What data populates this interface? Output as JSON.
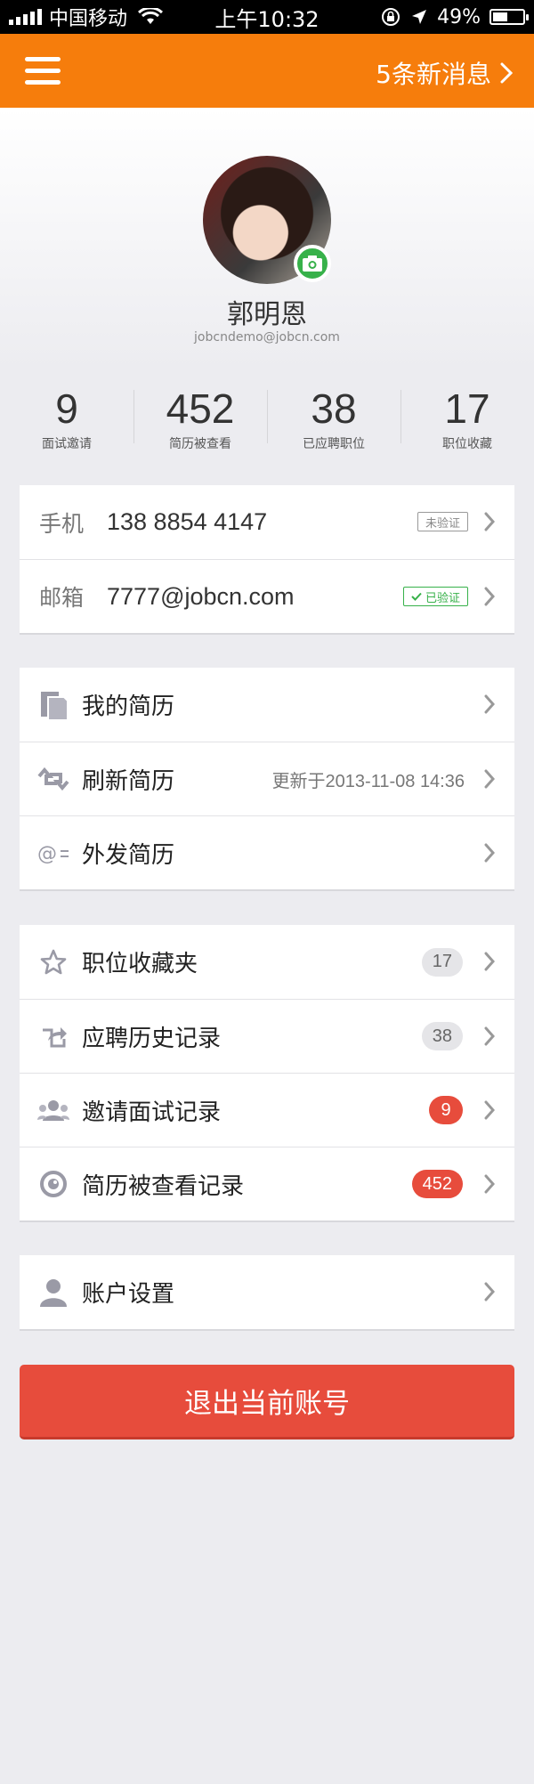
{
  "status_bar": {
    "carrier": "中国移动",
    "time": "上午10:32",
    "battery": "49%",
    "battery_level": 0.49
  },
  "header": {
    "menu_icon": "hamburger-menu-icon",
    "messages_label": "5条新消息"
  },
  "profile": {
    "name": "郭明恩",
    "email": "jobcndemo@jobcn.com"
  },
  "stats": [
    {
      "value": "9",
      "label": "面试邀请"
    },
    {
      "value": "452",
      "label": "简历被查看"
    },
    {
      "value": "38",
      "label": "已应聘职位"
    },
    {
      "value": "17",
      "label": "职位收藏"
    }
  ],
  "contact": {
    "phone": {
      "label": "手机",
      "value": "138 8854 4147",
      "status": "未验证"
    },
    "email": {
      "label": "邮箱",
      "value": "7777@jobcn.com",
      "status": "已验证"
    }
  },
  "resume": {
    "my_resume": "我的简历",
    "refresh": "刷新简历",
    "refresh_time": "更新于2013-11-08 14:36",
    "send": "外发简历"
  },
  "records": {
    "favorites": {
      "label": "职位收藏夹",
      "count": "17"
    },
    "applied": {
      "label": "应聘历史记录",
      "count": "38"
    },
    "interviews": {
      "label": "邀请面试记录",
      "count": "9"
    },
    "viewed": {
      "label": "简历被查看记录",
      "count": "452"
    }
  },
  "account": {
    "settings": "账户设置"
  },
  "logout_label": "退出当前账号",
  "colors": {
    "accent_orange": "#f67d0c",
    "verified_green": "#37b14a",
    "danger_red": "#e74c3c"
  }
}
